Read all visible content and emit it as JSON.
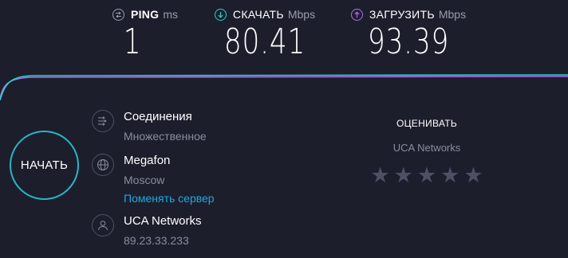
{
  "metrics": {
    "ping": {
      "label": "PING",
      "unit": "ms",
      "value": "1",
      "icon": "ping-icon"
    },
    "download": {
      "label": "СКАЧАТЬ",
      "unit": "Mbps",
      "value": "80.41",
      "icon": "download-arrow-icon",
      "color": "#27d3c9"
    },
    "upload": {
      "label": "ЗАГРУЗИТЬ",
      "unit": "Mbps",
      "value": "93.39",
      "icon": "upload-arrow-icon",
      "color": "#b06cf0"
    }
  },
  "start_button": {
    "label": "НАЧАТЬ",
    "color": "#27b6c9"
  },
  "connections": {
    "title": "Соединения",
    "value": "Множественное",
    "icon": "connections-icon"
  },
  "isp": {
    "name": "Megafon",
    "location": "Moscow",
    "change_server": "Поменять сервер",
    "icon": "globe-icon"
  },
  "host": {
    "name": "UCA Networks",
    "ip": "89.23.33.233",
    "icon": "user-icon"
  },
  "rating": {
    "title": "ОЦЕНИВАТЬ",
    "provider": "UCA Networks",
    "stars": 0,
    "max_stars": 5,
    "star_glyph": "★"
  },
  "colors": {
    "background": "#1d1e2c",
    "link": "#1fa8e0",
    "muted": "#8a8c9e",
    "download_line": "#27d3c9",
    "upload_line": "#b06cf0"
  }
}
